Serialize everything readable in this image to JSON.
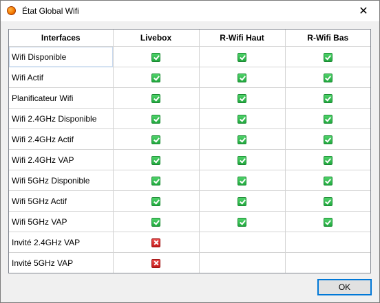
{
  "window": {
    "title": "État Global Wifi",
    "app_icon": "orange-circle-icon",
    "close_glyph": "✕"
  },
  "table": {
    "columns": [
      "Interfaces",
      "Livebox",
      "R-Wifi Haut",
      "R-Wifi Bas"
    ],
    "selected_row": 0,
    "rows": [
      {
        "label": "Wifi Disponible",
        "cells": [
          "ok",
          "ok",
          "ok"
        ]
      },
      {
        "label": "Wifi Actif",
        "cells": [
          "ok",
          "ok",
          "ok"
        ]
      },
      {
        "label": "Planificateur Wifi",
        "cells": [
          "ok",
          "ok",
          "ok"
        ]
      },
      {
        "label": "Wifi 2.4GHz Disponible",
        "cells": [
          "ok",
          "ok",
          "ok"
        ]
      },
      {
        "label": "Wifi 2.4GHz Actif",
        "cells": [
          "ok",
          "ok",
          "ok"
        ]
      },
      {
        "label": "Wifi 2.4GHz VAP",
        "cells": [
          "ok",
          "ok",
          "ok"
        ]
      },
      {
        "label": "Wifi 5GHz Disponible",
        "cells": [
          "ok",
          "ok",
          "ok"
        ]
      },
      {
        "label": "Wifi 5GHz Actif",
        "cells": [
          "ok",
          "ok",
          "ok"
        ]
      },
      {
        "label": "Wifi 5GHz VAP",
        "cells": [
          "ok",
          "ok",
          "ok"
        ]
      },
      {
        "label": "Invité 2.4GHz VAP",
        "cells": [
          "error",
          "",
          ""
        ]
      },
      {
        "label": "Invité 5GHz VAP",
        "cells": [
          "error",
          "",
          ""
        ]
      }
    ]
  },
  "status_icons": {
    "ok": "green-check-icon",
    "error": "red-cross-icon"
  },
  "colors": {
    "ok": "#22a83f",
    "error": "#c41c1c",
    "focus_border": "#0078d7"
  },
  "footer": {
    "ok_label": "OK"
  }
}
